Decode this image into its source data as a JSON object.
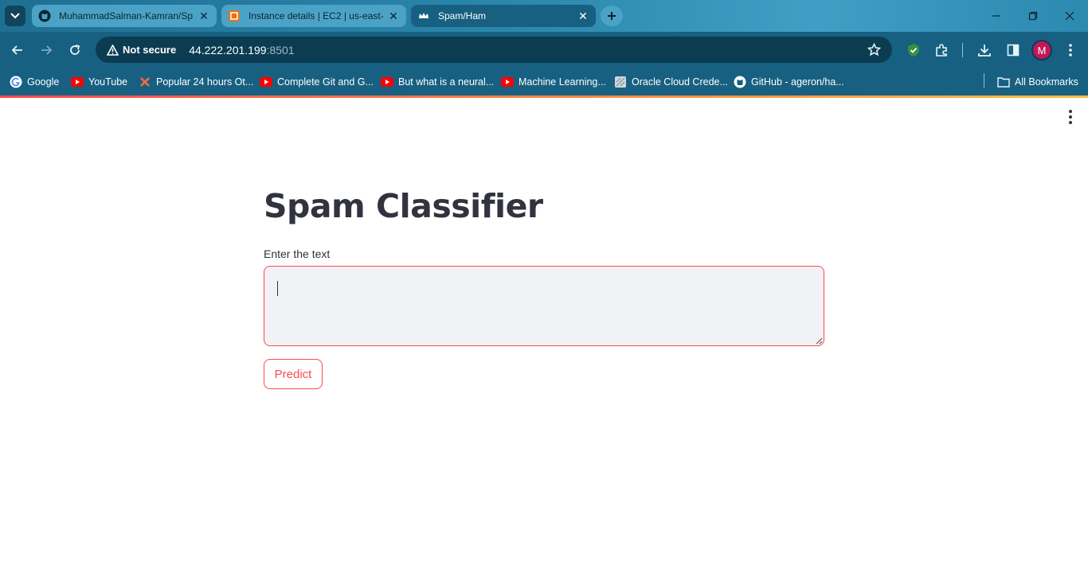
{
  "browser": {
    "tabs": [
      {
        "title": "MuhammadSalman-Kamran/Sp",
        "favicon": "github-icon",
        "active": false
      },
      {
        "title": "Instance details | EC2 | us-east-",
        "favicon": "aws-icon",
        "active": false
      },
      {
        "title": "Spam/Ham",
        "favicon": "streamlit-crown-icon",
        "active": true
      }
    ],
    "security_label": "Not secure",
    "url_host": "44.222.201.199",
    "url_port": ":8501",
    "profile_initial": "M",
    "bookmarks": [
      {
        "label": "Google",
        "icon": "google-icon"
      },
      {
        "label": "YouTube",
        "icon": "youtube-icon"
      },
      {
        "label": "Popular 24 hours Ot...",
        "icon": "x-icon"
      },
      {
        "label": "Complete Git and G...",
        "icon": "youtube-icon"
      },
      {
        "label": "But what is a neural...",
        "icon": "youtube-icon"
      },
      {
        "label": "Machine Learning...",
        "icon": "youtube-icon"
      },
      {
        "label": "Oracle Cloud Crede...",
        "icon": "oracle-icon"
      },
      {
        "label": "GitHub - ageron/ha...",
        "icon": "github-icon"
      }
    ],
    "all_bookmarks_label": "All Bookmarks"
  },
  "app": {
    "title": "Spam Classifier",
    "input_label": "Enter the text",
    "input_value": "",
    "predict_label": "Predict"
  },
  "colors": {
    "accent": "#ff4b4b",
    "text": "#31333f",
    "input_bg": "#f0f2f6",
    "chrome": "#176081"
  }
}
